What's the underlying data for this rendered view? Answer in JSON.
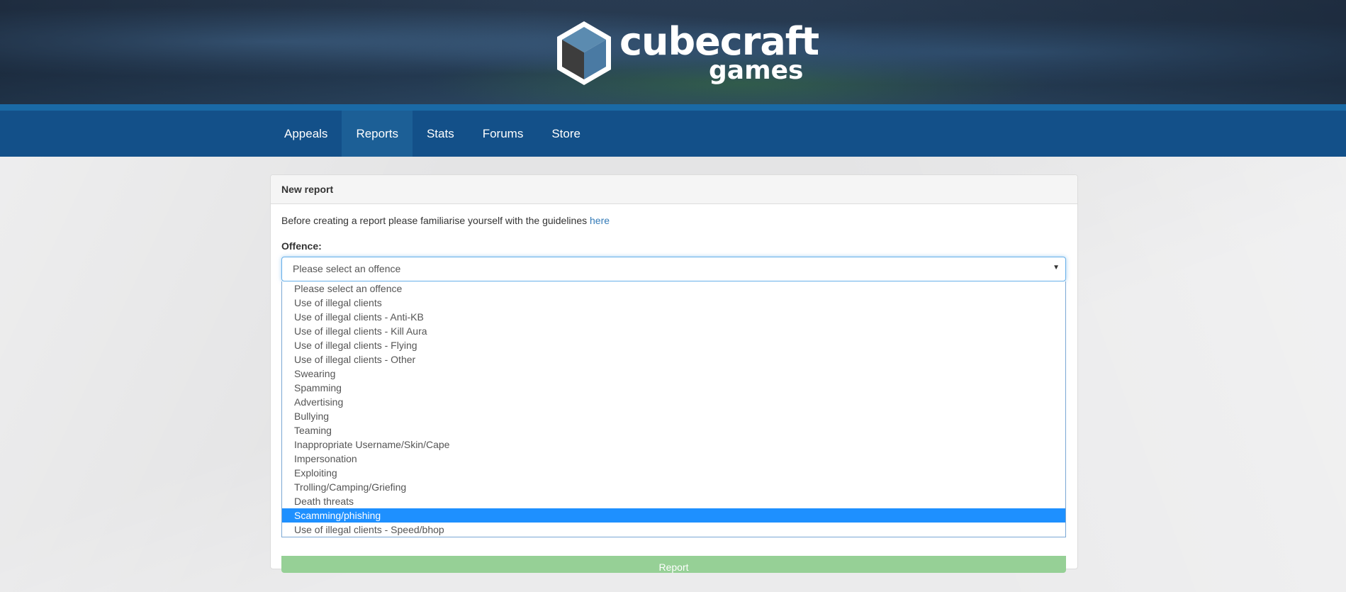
{
  "logo": {
    "word1": "cubecraft",
    "word2": "games"
  },
  "nav": {
    "items": [
      {
        "label": "Appeals",
        "active": false
      },
      {
        "label": "Reports",
        "active": true
      },
      {
        "label": "Stats",
        "active": false
      },
      {
        "label": "Forums",
        "active": false
      },
      {
        "label": "Store",
        "active": false
      }
    ]
  },
  "panel": {
    "title": "New report",
    "intro_text": "Before creating a report please familiarise yourself with the guidelines ",
    "intro_link": "here",
    "offence_label": "Offence:",
    "select_value": "Please select an offence",
    "report_button": "Report"
  },
  "dropdown": {
    "selected_index": 16,
    "options": [
      "Please select an offence",
      "Use of illegal clients",
      "Use of illegal clients - Anti-KB",
      "Use of illegal clients - Kill Aura",
      "Use of illegal clients - Flying",
      "Use of illegal clients - Other",
      "Swearing",
      "Spamming",
      "Advertising",
      "Bullying",
      "Teaming",
      "Inappropriate Username/Skin/Cape",
      "Impersonation",
      "Exploiting",
      "Trolling/Camping/Griefing",
      "Death threats",
      "Scamming/phishing",
      "Use of illegal clients - Speed/bhop"
    ]
  },
  "colors": {
    "nav_bg": "#135089",
    "nav_active": "#1c5f96",
    "link": "#337ab7",
    "selected_option": "#1e90ff",
    "report_button": "#96d096"
  }
}
